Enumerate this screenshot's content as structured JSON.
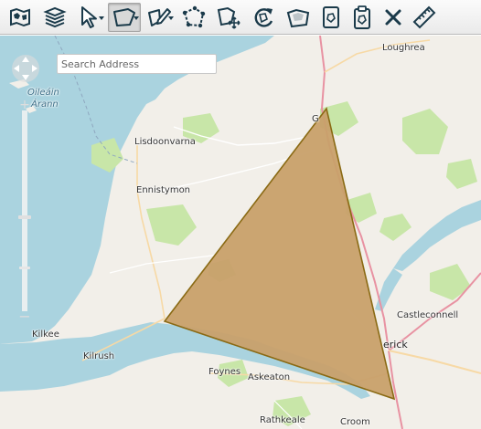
{
  "toolbar": {
    "tools": [
      {
        "name": "map-layers-icon"
      },
      {
        "name": "stack-icon"
      },
      {
        "name": "select-pointer-icon"
      },
      {
        "name": "draw-polygon-icon",
        "active": true
      },
      {
        "name": "edit-shape-icon"
      },
      {
        "name": "reshape-icon"
      },
      {
        "name": "move-shape-icon"
      },
      {
        "name": "rotate-shape-icon"
      },
      {
        "name": "shape-clipboard-icon"
      },
      {
        "name": "copy-shape-icon"
      },
      {
        "name": "paste-shape-icon"
      },
      {
        "name": "delete-icon"
      },
      {
        "name": "measure-ruler-icon"
      }
    ]
  },
  "search": {
    "placeholder": "Search Address"
  },
  "places": {
    "loughrea": "Loughrea",
    "oileain_a": "Oileáin",
    "oileain_b": "Árann",
    "lisdoonvarna": "Lisdoonvarna",
    "ennistymon": "Ennistymon",
    "castleconnell": "Castleconnell",
    "kilkee": "Kilkee",
    "kilrush": "Kilrush",
    "limerick_partial": "erick",
    "foynes": "Foynes",
    "askeaton": "Askeaton",
    "rathkeale": "Rathkeale",
    "croom": "Croom",
    "gort_partial": "G"
  },
  "colors": {
    "sea": "#aad3df",
    "land": "#f2efe9",
    "park": "#c8e6a8",
    "polygon_fill": "#c8a06a",
    "polygon_stroke": "#8a6a14",
    "icon": "#1a3a4a"
  }
}
